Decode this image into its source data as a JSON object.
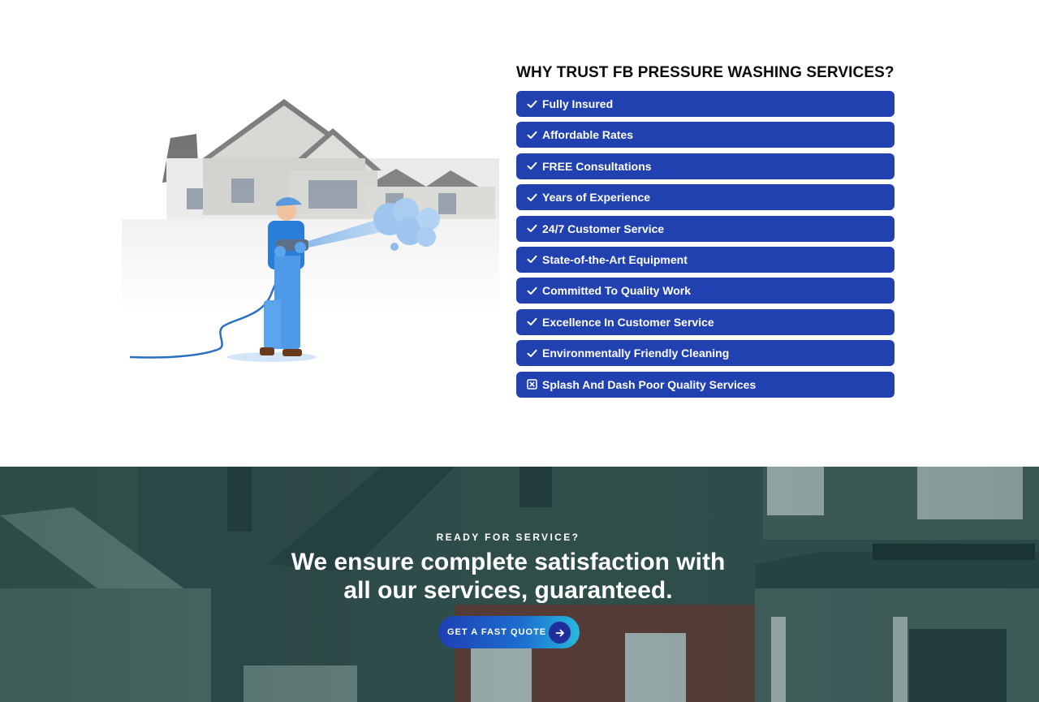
{
  "trust": {
    "title": "WHY TRUST FB PRESSURE WASHING SERVICES?",
    "items": [
      {
        "label": "Fully Insured",
        "icon": "check-icon"
      },
      {
        "label": "Affordable Rates",
        "icon": "check-icon"
      },
      {
        "label": "FREE Consultations",
        "icon": "check-icon"
      },
      {
        "label": "Years of Experience",
        "icon": "check-icon"
      },
      {
        "label": "24/7 Customer Service",
        "icon": "check-icon"
      },
      {
        "label": "State-of-the-Art Equipment",
        "icon": "check-icon"
      },
      {
        "label": "Committed To Quality Work",
        "icon": "check-icon"
      },
      {
        "label": "Excellence In Customer Service",
        "icon": "check-icon"
      },
      {
        "label": "Environmentally Friendly Cleaning",
        "icon": "check-icon"
      },
      {
        "label": "Splash And Dash Poor Quality Services",
        "icon": "x-box-icon"
      }
    ],
    "item_color": "#2141b1"
  },
  "cta": {
    "eyebrow": "READY FOR SERVICE?",
    "heading_line1": "We ensure complete satisfaction with",
    "heading_line2": "all our services, guaranteed.",
    "button_label": "GET A FAST QUOTE",
    "button_icon": "arrow-right-icon"
  }
}
